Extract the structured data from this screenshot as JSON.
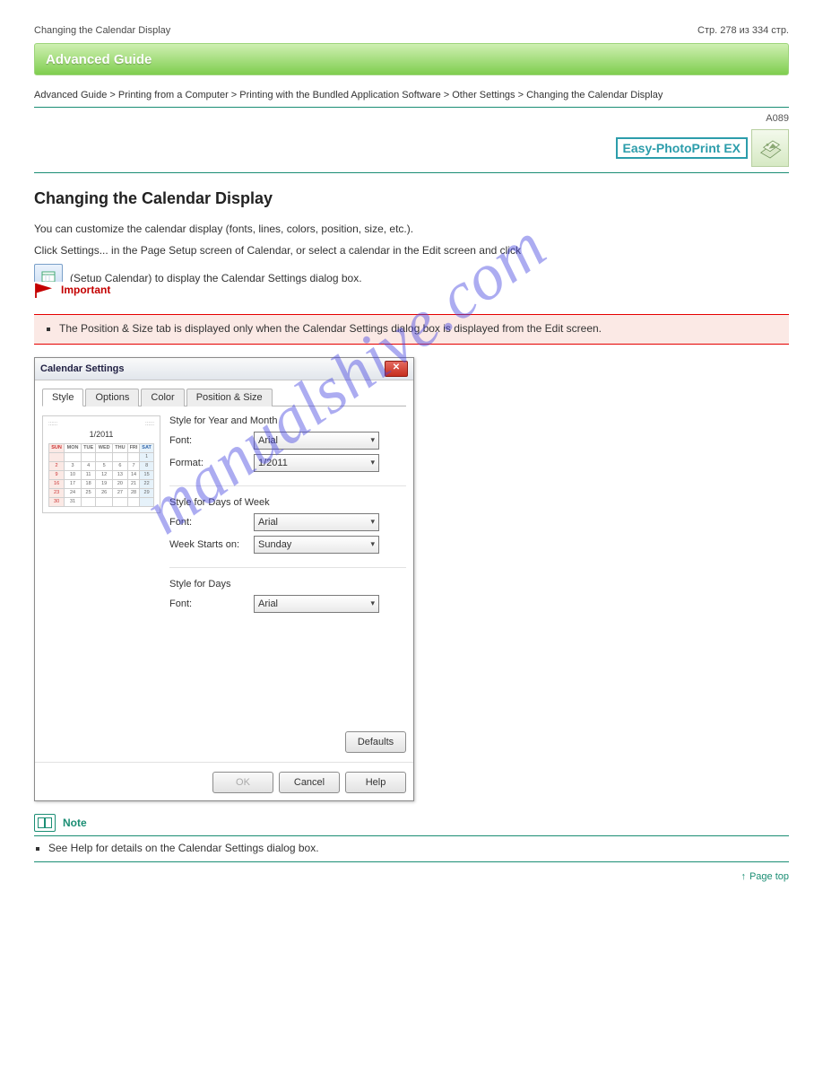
{
  "header": {
    "left": "Changing the Calendar Display",
    "right": "Стр. 278 из 334 стр."
  },
  "banner": "Advanced Guide",
  "breadcrumb": "Advanced Guide > Printing from a Computer > Printing with the Bundled Application Software > Other Settings > Changing the Calendar Display",
  "code": "A089",
  "logo": "Easy-PhotoPrint EX",
  "title": "Changing the Calendar Display",
  "para1": "You can customize the calendar display (fonts, lines, colors, position, size, etc.).",
  "para2_a": "Click Settings... in the Page Setup screen of Calendar, or select a calendar in the Edit screen and click",
  "para2_b": "(Setup Calendar) to display the Calendar Settings dialog box.",
  "important": {
    "label": "Important",
    "text": "The Position & Size tab is displayed only when the Calendar Settings dialog box is displayed from the Edit screen."
  },
  "dialog": {
    "title": "Calendar Settings",
    "tabs": [
      "Style",
      "Options",
      "Color",
      "Position & Size"
    ],
    "preview_month": "1/2011",
    "days": [
      "SUN",
      "MON",
      "TUE",
      "WED",
      "THU",
      "FRI",
      "SAT"
    ],
    "yearMonth": {
      "heading": "Style for Year and Month",
      "font_label": "Font:",
      "font_value": "Arial",
      "format_label": "Format:",
      "format_value": "1/2011"
    },
    "week": {
      "heading": "Style for Days of Week",
      "font_label": "Font:",
      "font_value": "Arial",
      "starts_label": "Week Starts on:",
      "starts_value": "Sunday"
    },
    "days_sec": {
      "heading": "Style for Days",
      "font_label": "Font:",
      "font_value": "Arial"
    },
    "defaults": "Defaults",
    "ok": "OK",
    "cancel": "Cancel",
    "help": "Help"
  },
  "note": {
    "label": "Note",
    "text": "See Help for details on the Calendar Settings dialog box."
  },
  "pagetop": "Page top",
  "watermark": "manualshive.com"
}
